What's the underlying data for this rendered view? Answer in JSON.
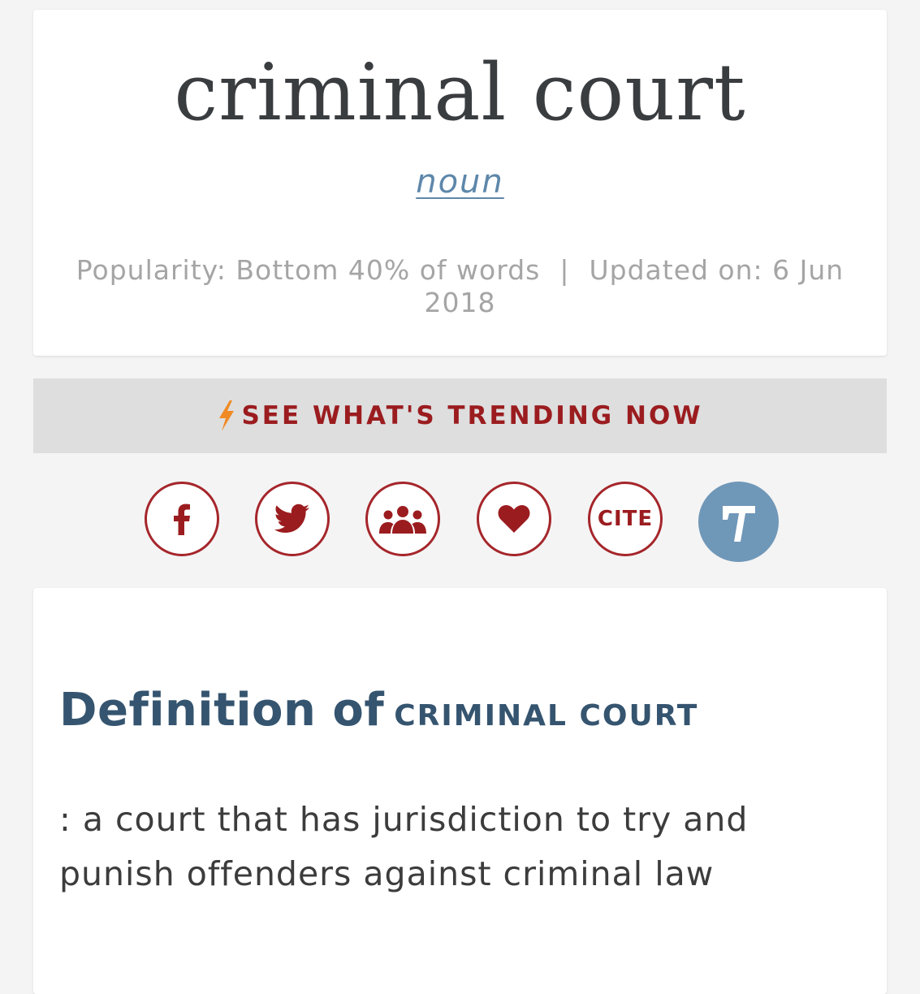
{
  "entry": {
    "headword": "criminal court",
    "part_of_speech": "noun",
    "popularity": "Popularity: Bottom 40% of words",
    "separator": "|",
    "updated": "Updated on: 6 Jun 2018"
  },
  "trending": {
    "label": "SEE WHAT'S TRENDING NOW"
  },
  "share": {
    "buttons": [
      {
        "name": "facebook",
        "icon": "facebook-icon"
      },
      {
        "name": "twitter",
        "icon": "twitter-icon"
      },
      {
        "name": "community",
        "icon": "group-icon"
      },
      {
        "name": "favorite",
        "icon": "heart-icon"
      },
      {
        "name": "cite",
        "label": "CITE"
      },
      {
        "name": "thesaurus",
        "icon": "thesaurus-t-icon"
      }
    ]
  },
  "definition": {
    "heading": "Definition of",
    "term": "CRIMINAL COURT",
    "text": ": a court that has jurisdiction to try and punish offenders against criminal law"
  },
  "colors": {
    "background": "#f4f4f4",
    "card": "#ffffff",
    "brand_red": "#9b1c1f",
    "link_blue": "#5e87aa",
    "heading_blue": "#35546f",
    "thesaurus_blue": "#6f97b8",
    "bolt_orange": "#f08a24"
  }
}
